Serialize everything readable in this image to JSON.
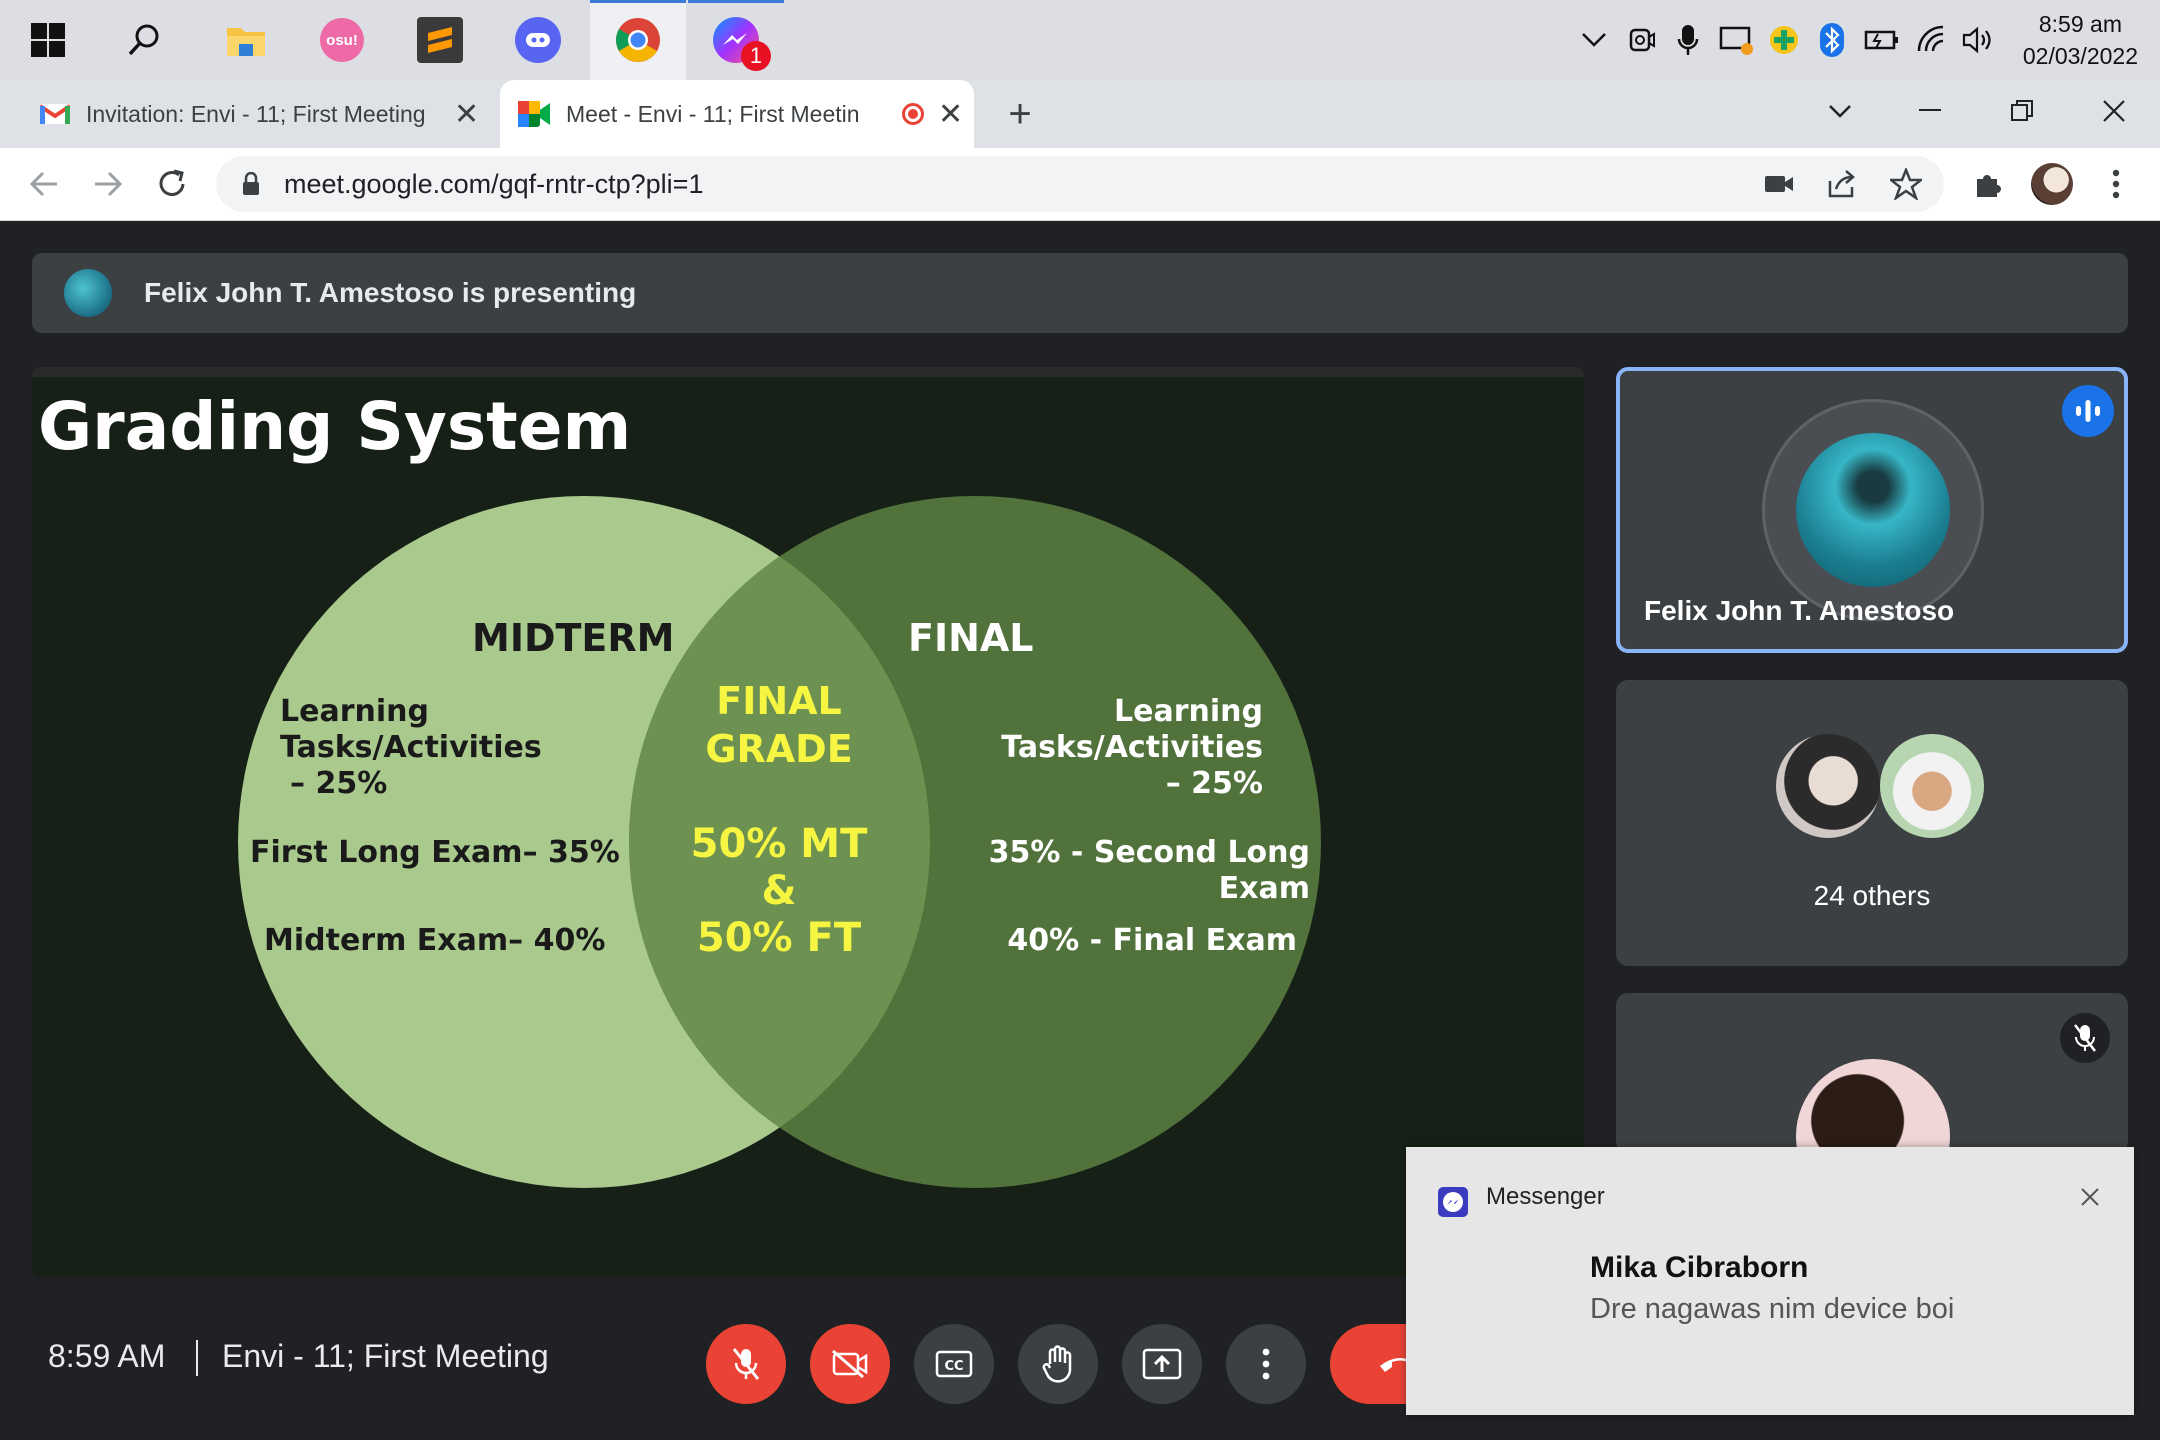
{
  "taskbar": {
    "apps": [
      {
        "name": "windows-start",
        "active": false
      },
      {
        "name": "search",
        "active": false
      },
      {
        "name": "file-explorer",
        "active": false
      },
      {
        "name": "osu",
        "label": "osu!",
        "active": false
      },
      {
        "name": "sublime-text",
        "active": false
      },
      {
        "name": "discord",
        "active": false
      },
      {
        "name": "chrome",
        "active": true
      },
      {
        "name": "messenger",
        "badge": "1",
        "active": false
      }
    ],
    "clock": {
      "time": "8:59 am",
      "date": "02/03/2022"
    }
  },
  "browser": {
    "tabs": [
      {
        "title": "Invitation: Envi - 11; First Meeting",
        "icon": "gmail-icon",
        "active": false
      },
      {
        "title": "Meet - Envi - 11; First Meetin",
        "icon": "meet-icon",
        "recording": true,
        "active": true
      }
    ],
    "url": "meet.google.com/gqf-rntr-ctp?pli=1"
  },
  "meet": {
    "presenting_banner": "Felix John T. Amestoso is presenting",
    "slide": {
      "title": "Grading System",
      "midterm": {
        "heading": "MIDTERM",
        "lines": [
          "Learning",
          "Tasks/Activities",
          "– 25%",
          "First Long Exam– 35%",
          "Midterm Exam– 40%"
        ]
      },
      "final": {
        "heading": "FINAL",
        "lines": [
          "Learning",
          "Tasks/Activities",
          "– 25%",
          "35% - Second Long",
          "Exam",
          "40% - Final Exam"
        ]
      },
      "overlap": {
        "heading_1": "FINAL",
        "heading_2": "GRADE",
        "line_1": "50% MT",
        "line_2": "&",
        "line_3": "50% FT"
      }
    },
    "participants": {
      "presenter_name": "Felix John T. Amestoso",
      "others_label": "24 others"
    },
    "footer": {
      "time": "8:59 AM",
      "meeting_name": "Envi - 11; First Meeting"
    }
  },
  "notification": {
    "app": "Messenger",
    "sender": "Mika Cibraborn",
    "message": "Dre nagawas nim device boi"
  },
  "colors": {
    "meet_bg": "#202124",
    "accent_blue": "#8ab4f8",
    "danger_red": "#ea4335",
    "slide_yellow": "#f5f542",
    "circle_left": "#a9c98d",
    "circle_right": "#587a3f"
  }
}
